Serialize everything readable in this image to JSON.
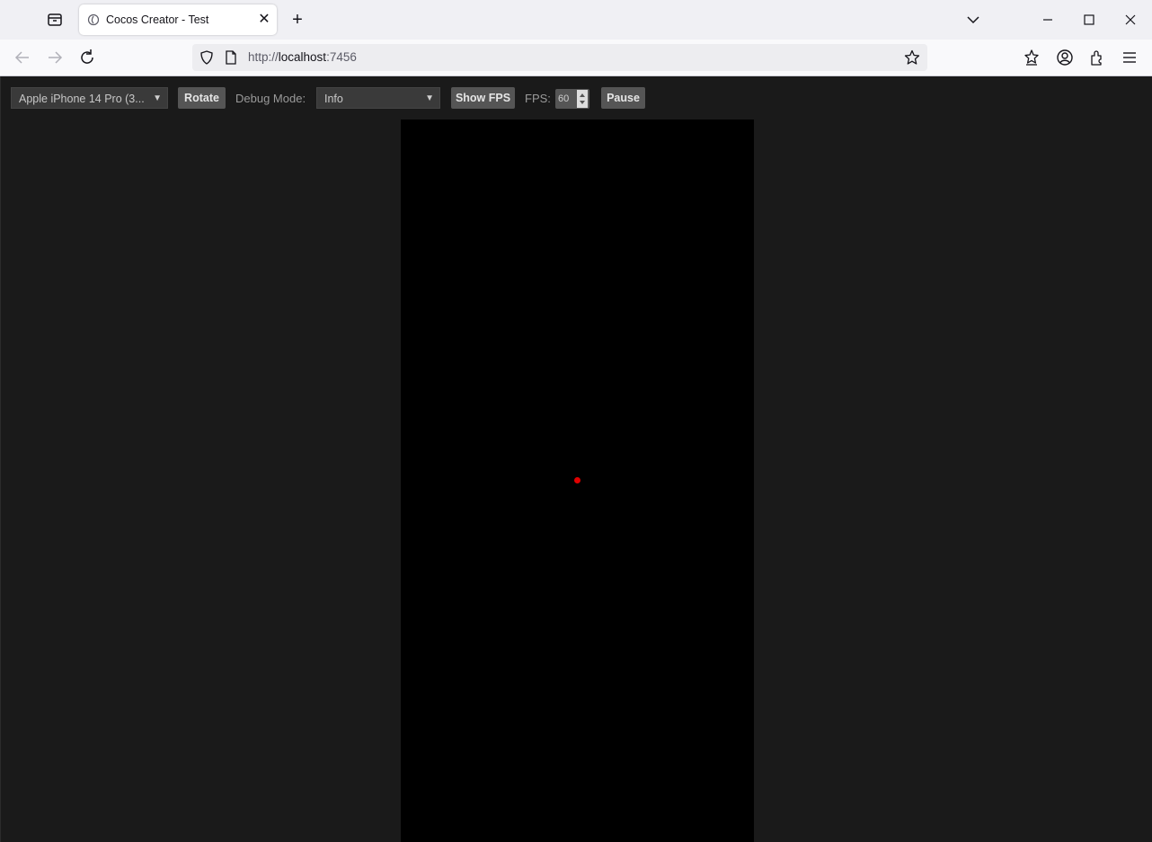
{
  "browser": {
    "tab": {
      "title": "Cocos Creator - Test",
      "close_glyph": "✕"
    },
    "new_tab_glyph": "+",
    "url": {
      "scheme": "http://",
      "host": "localhost",
      "port": ":7456"
    },
    "icons": {
      "tab_list": "tab-list-icon",
      "back": "back-arrow-icon",
      "forward": "forward-arrow-icon",
      "reload": "reload-icon",
      "shield": "shield-icon",
      "page": "page-icon",
      "bookmark": "star-icon",
      "pocket": "save-to-pocket-icon",
      "account": "account-icon",
      "extensions": "extensions-icon",
      "menu": "hamburger-menu-icon"
    }
  },
  "preview_toolbar": {
    "device_select": "Apple iPhone 14 Pro (3...",
    "rotate_label": "Rotate",
    "debug_mode_label": "Debug Mode:",
    "debug_mode_value": "Info",
    "show_fps_label": "Show FPS",
    "fps_label": "FPS:",
    "fps_value": "60",
    "pause_label": "Pause"
  },
  "colors": {
    "page_background": "#1a1a1a",
    "canvas_background": "#000000",
    "dot": "#e00000"
  }
}
